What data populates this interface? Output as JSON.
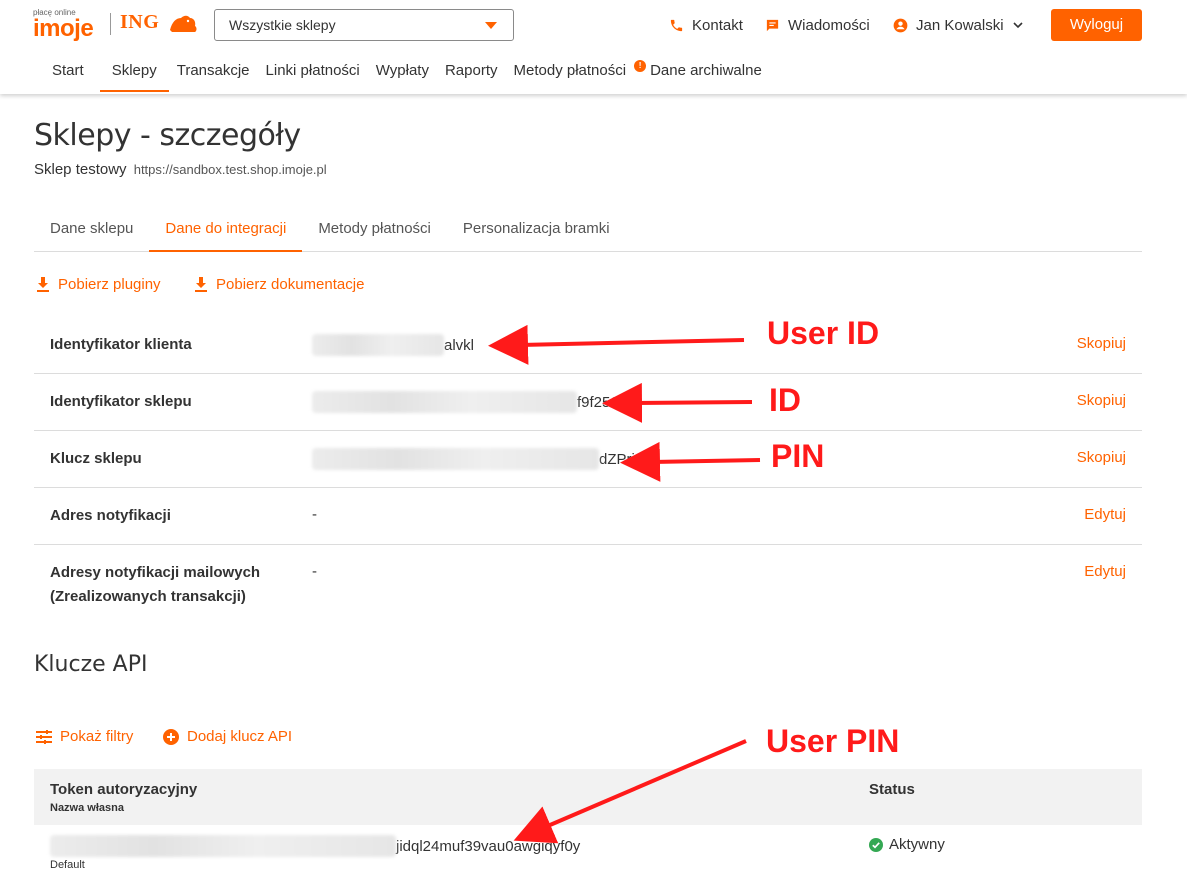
{
  "header": {
    "logo_small": "płacę online",
    "logo_main": "imoje",
    "logo_ing": "ING",
    "shop_select_value": "Wszystkie sklepy",
    "contact": "Kontakt",
    "messages": "Wiadomości",
    "user_name": "Jan Kowalski",
    "logout": "Wyloguj",
    "accent_color": "#ff6200"
  },
  "nav": {
    "items": [
      {
        "label": "Start"
      },
      {
        "label": "Sklepy",
        "active": true
      },
      {
        "label": "Transakcje"
      },
      {
        "label": "Linki płatności"
      },
      {
        "label": "Wypłaty"
      },
      {
        "label": "Raporty"
      },
      {
        "label": "Metody płatności",
        "badge": "!"
      },
      {
        "label": "Dane archiwalne"
      }
    ]
  },
  "page": {
    "title": "Sklepy - szczegóły",
    "shop_name": "Sklep testowy",
    "shop_url": "https://sandbox.test.shop.imoje.pl"
  },
  "tabs": [
    {
      "label": "Dane sklepu"
    },
    {
      "label": "Dane do integracji",
      "active": true
    },
    {
      "label": "Metody płatności"
    },
    {
      "label": "Personalizacja bramki"
    }
  ],
  "actions": {
    "download_plugins": "Pobierz pluginy",
    "download_docs": "Pobierz dokumentacje"
  },
  "details": [
    {
      "label": "Identyfikator klienta",
      "value_suffix": "alvkl",
      "action": "Skopiuj"
    },
    {
      "label": "Identyfikator sklepu",
      "value_suffix": "f9f25638",
      "action": "Skopiuj"
    },
    {
      "label": "Klucz sklepu",
      "value_suffix": "dZPrjv4k",
      "action": "Skopiuj"
    },
    {
      "label": "Adres notyfikacji",
      "value": "-",
      "action": "Edytuj"
    },
    {
      "label_line1": "Adresy notyfikacji mailowych",
      "label_line2": "(Zrealizowanych transakcji)",
      "value": "-",
      "action": "Edytuj"
    }
  ],
  "annotations": {
    "user_id": "User ID",
    "id": "ID",
    "pin": "PIN",
    "user_pin": "User PIN",
    "color": "#ff1a1a"
  },
  "api_keys": {
    "title": "Klucze API",
    "show_filters": "Pokaż filtry",
    "add_key": "Dodaj klucz API",
    "col_token": "Token autoryzacyjny",
    "col_token_sub": "Nazwa własna",
    "col_status": "Status",
    "rows": [
      {
        "token_suffix": "jidql24muf39vau0awgiqyf0y",
        "name": "Default",
        "status": "Aktywny"
      }
    ]
  }
}
